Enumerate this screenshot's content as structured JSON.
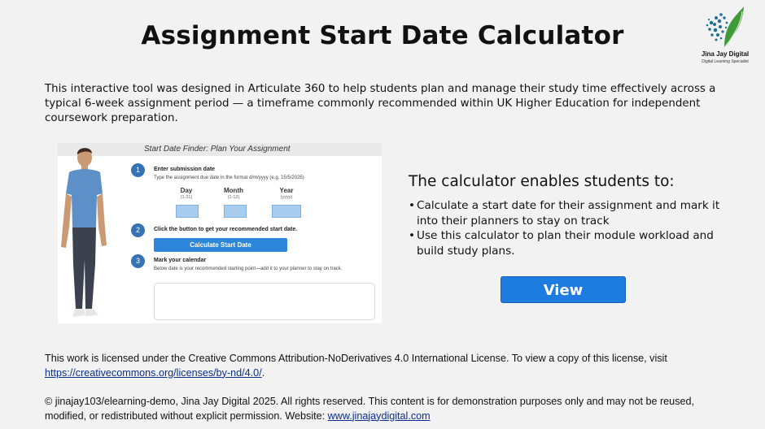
{
  "page": {
    "title": "Assignment Start Date Calculator",
    "intro": "This interactive tool was designed in Articulate 360 to help students plan and manage their study time effectively across a typical 6-week assignment period — a timeframe commonly recommended within UK Higher Education for independent coursework preparation."
  },
  "logo": {
    "name": "Jina Jay Digital",
    "tagline": "Digital Learning Specialist",
    "accent_color": "#3f9a3a",
    "dot_color": "#1f6f96"
  },
  "preview": {
    "title": "Start Date Finder: Plan Your Assignment",
    "steps": [
      {
        "number": "1",
        "title": "Enter submission date",
        "desc": "Type the assignment due date in the format d/m/yyyy (e.g. 15/5/2025)"
      },
      {
        "number": "2",
        "title": "Click the button to get your recommended start date.",
        "desc": ""
      },
      {
        "number": "3",
        "title": "Mark your calendar",
        "desc": "Below date is your recommended starting point—add it to your planner to stay on track."
      }
    ],
    "fields": [
      {
        "label": "Day",
        "hint": "(1-31)"
      },
      {
        "label": "Month",
        "hint": "(1-12)"
      },
      {
        "label": "Year",
        "hint": "(yyyy)"
      }
    ],
    "button_label": "Calculate Start Date"
  },
  "features": {
    "heading": "The calculator enables students to:",
    "items": [
      "Calculate a start date for their assignment and mark it into their planners to stay on track",
      "Use this calculator to plan their module workload and build study plans."
    ],
    "bullet": "•"
  },
  "view_button": {
    "label": "View",
    "color": "#1e7be0"
  },
  "license": {
    "text": "This work is licensed under the Creative Commons Attribution-NoDerivatives 4.0 International License. To view a copy of this license, visit ",
    "link_text": "https://creativecommons.org/licenses/by-nd/4.0/",
    "after": "."
  },
  "copyright": {
    "text": "© jinajay103/elearning-demo, Jina Jay Digital 2025. All rights reserved. This content is for demonstration purposes only and may not be reused, modified, or redistributed without explicit permission. Website: ",
    "link_text": "www.jinajaydigital.com"
  }
}
